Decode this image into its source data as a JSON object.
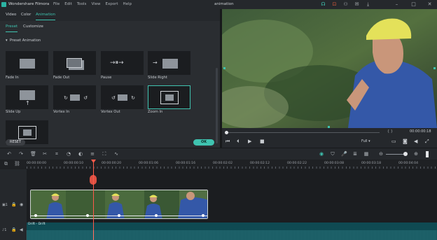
{
  "titlebar": {
    "app": "Wondershare Filmora",
    "menu": [
      "File",
      "Edit",
      "Tools",
      "View",
      "Export",
      "Help"
    ],
    "project": "animation"
  },
  "tabs": {
    "video": "Video",
    "color": "Color",
    "animation": "Animation"
  },
  "subtabs": {
    "preset": "Preset",
    "customize": "Customize"
  },
  "section": "Preset Animation",
  "presets": [
    "Fade In",
    "Fade Out",
    "Pause",
    "Slide Right",
    "Slide Up",
    "Vortex In",
    "Vortex Out",
    "Zoom In"
  ],
  "buttons": {
    "reset": "RESET",
    "ok": "OK"
  },
  "player": {
    "timecode": "00:00:00:18",
    "quality": "Full",
    "brackets": "{    }"
  },
  "ruler": [
    "00:00:00:00",
    "00:00:00:10",
    "00:00:00:20",
    "00:00:01:06",
    "00:00:01:16",
    "00:00:02:02",
    "00:00:02:12",
    "00:00:02:22",
    "00:00:03:08",
    "00:00:03:18",
    "00:00:04:04"
  ],
  "audio": {
    "label": "Drift - Drift"
  },
  "colors": {
    "accent": "#3fc3b0",
    "playhead": "#ff5a4a"
  }
}
